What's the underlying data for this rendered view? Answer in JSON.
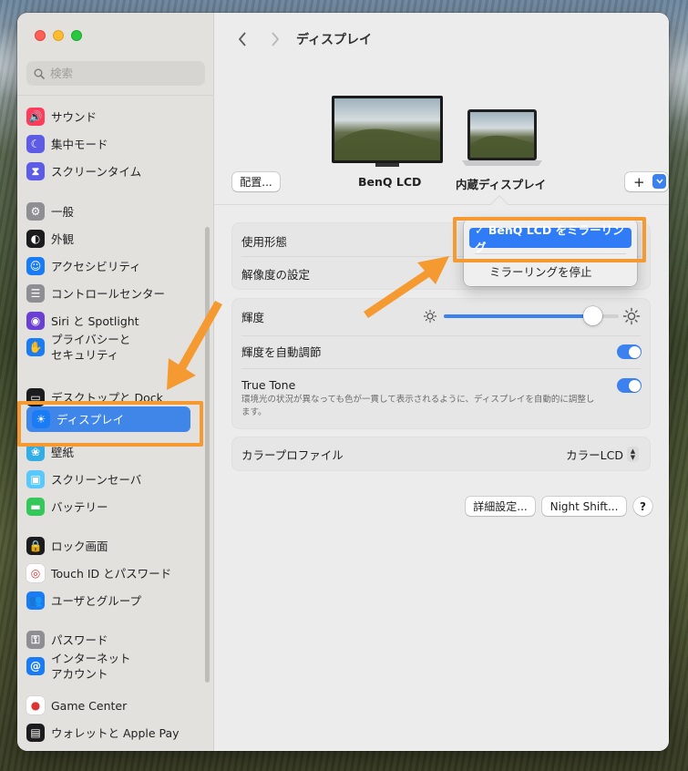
{
  "window": {
    "title": "ディスプレイ"
  },
  "search": {
    "placeholder": "検索"
  },
  "sidebar": {
    "items": [
      {
        "label": "サウンド",
        "icon": "speaker-icon",
        "color": "#ff3b5c"
      },
      {
        "label": "集中モード",
        "icon": "moon-icon",
        "color": "#5e5ce6"
      },
      {
        "label": "スクリーンタイム",
        "icon": "hourglass-icon",
        "color": "#5e5ce6"
      },
      {
        "label": "一般",
        "icon": "gear-icon",
        "color": "#8e8e93"
      },
      {
        "label": "外観",
        "icon": "appearance-icon",
        "color": "#1c1c1e"
      },
      {
        "label": "アクセシビリティ",
        "icon": "accessibility-icon",
        "color": "#1a7cf5"
      },
      {
        "label": "コントロールセンター",
        "icon": "control-center-icon",
        "color": "#8e8e93"
      },
      {
        "label": "Siri と Spotlight",
        "icon": "siri-icon",
        "color": "#6a3fd2"
      },
      {
        "label": "プライバシーと\nセキュリティ",
        "icon": "hand-icon",
        "color": "#1a7cf5"
      },
      {
        "label": "デスクトップと Dock",
        "icon": "dock-icon",
        "color": "#1c1c1e"
      },
      {
        "label": "ディスプレイ",
        "icon": "sun-icon",
        "color": "#1a7cf5"
      },
      {
        "label": "壁紙",
        "icon": "wallpaper-icon",
        "color": "#32ade6"
      },
      {
        "label": "スクリーンセーバ",
        "icon": "screensaver-icon",
        "color": "#5ac8fa"
      },
      {
        "label": "バッテリー",
        "icon": "battery-icon",
        "color": "#34c759"
      },
      {
        "label": "ロック画面",
        "icon": "lock-icon",
        "color": "#1c1c1e"
      },
      {
        "label": "Touch ID とパスワード",
        "icon": "fingerprint-icon",
        "color": "#ffffff"
      },
      {
        "label": "ユーザとグループ",
        "icon": "users-icon",
        "color": "#1a7cf5"
      },
      {
        "label": "パスワード",
        "icon": "key-icon",
        "color": "#8e8e93"
      },
      {
        "label": "インターネット\nアカウント",
        "icon": "at-icon",
        "color": "#1a7cf5"
      },
      {
        "label": "Game Center",
        "icon": "game-center-icon",
        "color": "#ffffff"
      },
      {
        "label": "ウォレットと Apple Pay",
        "icon": "wallet-icon",
        "color": "#1c1c1e"
      }
    ],
    "selected": "ディスプレイ"
  },
  "displays": {
    "arrangement_button": "配置...",
    "external": "BenQ LCD",
    "builtin": "内蔵ディスプレイ",
    "add_button": "+"
  },
  "settings": {
    "use_as_label": "使用形態",
    "resolution_label": "解像度の設定",
    "brightness_label": "輝度",
    "brightness_value": 0.85,
    "auto_brightness_label": "輝度を自動調節",
    "auto_brightness_on": true,
    "true_tone_label": "True Tone",
    "true_tone_desc": "環境光の状況が異なっても色が一貫して表示されるように、ディスプレイを自動的に調整します。",
    "true_tone_on": true,
    "color_profile_label": "カラープロファイル",
    "color_profile_value": "カラーLCD"
  },
  "menu": {
    "selected_item": "✓ BenQ LCD をミラーリング",
    "other_item": "ミラーリングを停止"
  },
  "footer": {
    "advanced_button": "詳細設定...",
    "night_shift_button": "Night Shift...",
    "help_button": "?"
  },
  "colors": {
    "accent": "#3b82f0",
    "annotation": "#f59a31"
  }
}
